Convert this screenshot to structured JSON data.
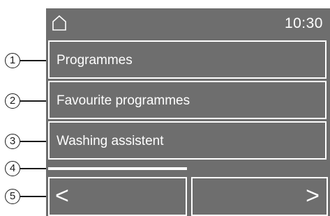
{
  "status_bar": {
    "home_icon": "home-icon",
    "time": "10:30"
  },
  "menu": {
    "items": [
      {
        "label": "Programmes"
      },
      {
        "label": "Favourite programmes"
      },
      {
        "label": "Washing assistent"
      }
    ]
  },
  "navigation": {
    "prev_label": "<",
    "next_label": ">"
  },
  "callouts": [
    "1",
    "2",
    "3",
    "4",
    "5"
  ],
  "colors": {
    "screen_background": "#6e6e6e",
    "foreground": "#ffffff",
    "callout": "#1a1a1a"
  }
}
